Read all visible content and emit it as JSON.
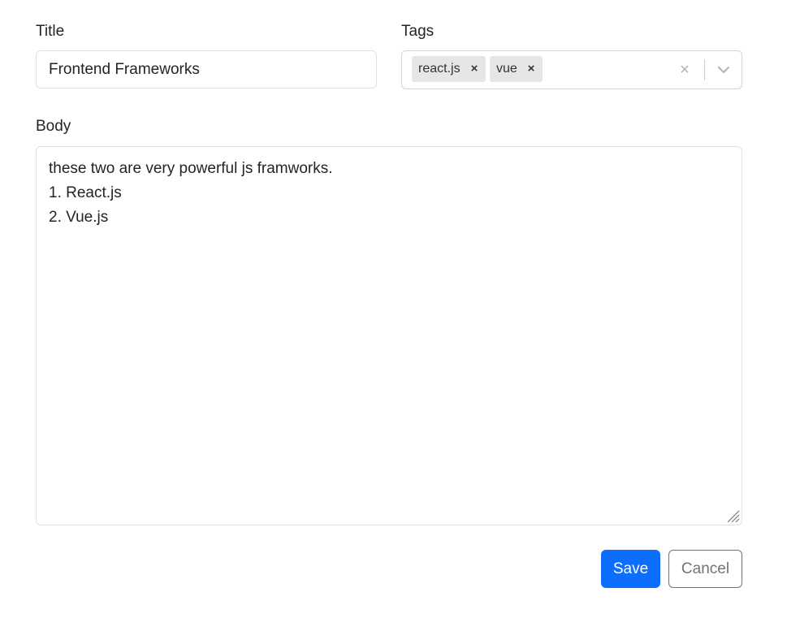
{
  "form": {
    "title_label": "Title",
    "title_value": "Frontend Frameworks",
    "tags_label": "Tags",
    "tags": [
      {
        "label": "react.js",
        "remove": "×"
      },
      {
        "label": "vue",
        "remove": "×"
      }
    ],
    "clear_icon": "×",
    "body_label": "Body",
    "body_value": "these two are very powerful js framworks.\n1. React.js\n2. Vue.js",
    "save_label": "Save",
    "cancel_label": "Cancel"
  },
  "colors": {
    "primary": "#0d6efd",
    "secondary": "#6c757d",
    "chip_bg": "#e6e6e6",
    "border": "#dee2e6"
  },
  "icons": {
    "tag_remove": "close-icon",
    "clear": "clear-icon",
    "dropdown": "chevron-down-icon",
    "resize": "resize-grip-icon"
  }
}
